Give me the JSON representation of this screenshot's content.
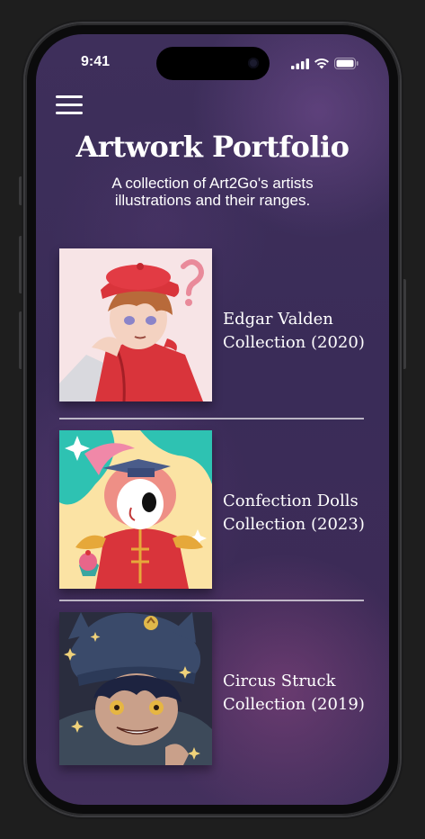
{
  "status_bar": {
    "time": "9:41"
  },
  "header": {
    "title": "Artwork Portfolio",
    "subtitle": "A collection of Art2Go's artists illustrations and their ranges."
  },
  "collections": [
    {
      "title": "Edgar Valden",
      "subtitle": "Collection (2020)"
    },
    {
      "title": "Confection Dolls",
      "subtitle": "Collection (2023)"
    },
    {
      "title": "Circus Struck",
      "subtitle": "Collection (2019)"
    }
  ],
  "icons": {
    "menu": "hamburger-menu-icon",
    "signal": "cellular-signal-icon",
    "wifi": "wifi-icon",
    "battery": "battery-icon"
  },
  "colors": {
    "background": "#3e2f5b",
    "text": "#ffffff",
    "divider": "#d6d0df"
  }
}
